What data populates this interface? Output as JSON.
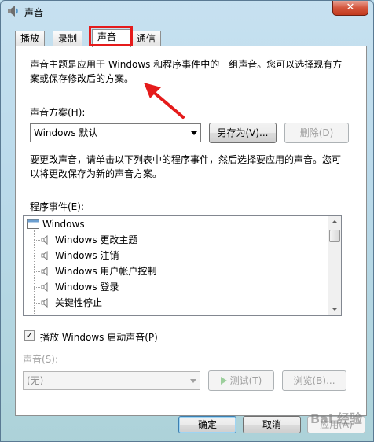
{
  "window": {
    "title": "声音",
    "close_label": "✕"
  },
  "tabs": [
    {
      "label": "播放"
    },
    {
      "label": "录制"
    },
    {
      "label": "声音"
    },
    {
      "label": "通信"
    }
  ],
  "sounds_tab": {
    "intro_line1": "声音主题是应用于 Windows 和程序事件中的一组声音。您可以选择现有方",
    "intro_line2": "案或保存修改后的方案。",
    "scheme_label": "声音方案(H):",
    "scheme_value": "Windows 默认",
    "save_as_button": "另存为(V)...",
    "delete_button": "删除(D)",
    "instructions_line1": "要更改声音，请单击以下列表中的程序事件，然后选择要应用的声音。您可",
    "instructions_line2": "以将更改保存为新的声音方案。",
    "events_label": "程序事件(E):",
    "events": [
      {
        "label": "Windows",
        "root": true
      },
      {
        "label": "Windows 更改主题"
      },
      {
        "label": "Windows 注销"
      },
      {
        "label": "Windows 用户帐户控制"
      },
      {
        "label": "Windows 登录"
      },
      {
        "label": "关键性停止"
      }
    ],
    "startup_checkbox_label": "播放 Windows 启动声音(P)",
    "startup_checked": true,
    "sounds_label": "声音(S):",
    "sound_value": "(无)",
    "test_button": "测试(T)",
    "browse_button": "浏览(B)..."
  },
  "footer": {
    "ok_button": "确定",
    "cancel_button": "取消",
    "apply_button": "应用(A)"
  },
  "watermark": "Bai 经验"
}
